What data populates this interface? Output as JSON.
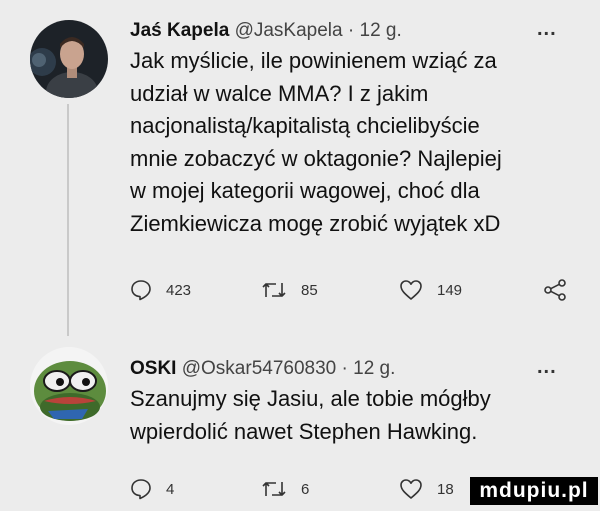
{
  "tweets": [
    {
      "name": "Jaś Kapela",
      "handle": "@JasKapela",
      "separator": "·",
      "time": "12 g.",
      "more": "...",
      "lines": [
        "Jak myślicie, ile powinienem wziąć za",
        "udział w walce MMA? I z jakim",
        "nacjonalistą/kapitalistą chcielibyście",
        "mnie zobaczyć w oktagonie? Najlepiej",
        "w mojej kategorii wagowej, choć dla",
        "Ziemkiewicza mogę zrobić wyjątek xD"
      ],
      "replies": "423",
      "retweets": "85",
      "likes": "149"
    },
    {
      "name": "OSKI",
      "handle": "@Oskar54760830",
      "separator": "·",
      "time": "12 g.",
      "more": "...",
      "lines": [
        "Szanujmy się Jasiu, ale tobie mógłby",
        "wpierdolić nawet Stephen Hawking."
      ],
      "replies": "4",
      "retweets": "6",
      "likes": "18"
    }
  ],
  "icons": {
    "reply": "reply-icon",
    "retweet": "retweet-icon",
    "like": "heart-icon",
    "share": "share-icon"
  },
  "watermark": "mdupiu.pl"
}
